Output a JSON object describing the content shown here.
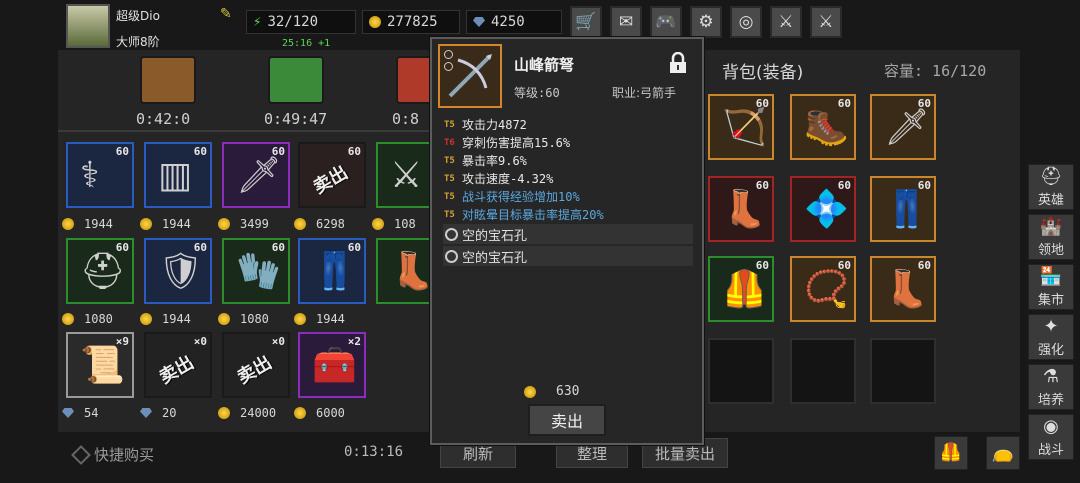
{
  "player": {
    "name": "超级Dio",
    "rank": "大师8阶"
  },
  "stats": {
    "energy": "32/120",
    "energy_timer": "25:16 +1",
    "gold": "277825",
    "gems": "4250"
  },
  "top_buttons": [
    {
      "name": "shop-cart",
      "icon": "🛒"
    },
    {
      "name": "mail",
      "icon": "✉"
    },
    {
      "name": "gamepad",
      "icon": "🎮"
    },
    {
      "name": "settings",
      "icon": "⚙"
    },
    {
      "name": "color-wheel",
      "icon": "◎"
    },
    {
      "name": "claws",
      "icon": "⚔"
    },
    {
      "name": "crossed-swords",
      "icon": "⚔"
    }
  ],
  "chests": [
    {
      "timer": "0:42:0",
      "color": "#8b5a2b"
    },
    {
      "timer": "0:49:47",
      "color": "#3a8a3a"
    },
    {
      "timer": "0:8",
      "color": "#b03a2a"
    }
  ],
  "shop": {
    "rows": [
      [
        {
          "level": "60",
          "price": "1944",
          "border": "#2a5bbf",
          "bg": "#1b2640",
          "art": "⚕"
        },
        {
          "level": "60",
          "price": "1944",
          "border": "#2a5bbf",
          "bg": "#1b2640",
          "art": "▥"
        },
        {
          "level": "60",
          "price": "3499",
          "border": "#8a2dbf",
          "bg": "#2a1b3a",
          "art": "🗡"
        },
        {
          "level": "60",
          "price": "6298",
          "border": "#1a1a1a",
          "bg": "#2a2020",
          "sold": "卖出",
          "art": ""
        },
        {
          "level": "",
          "price": "108",
          "border": "#2b8d2b",
          "bg": "#1a2a1a",
          "art": "⚔"
        }
      ],
      [
        {
          "level": "60",
          "price": "1080",
          "border": "#2b8d2b",
          "bg": "#1a2a1a",
          "art": "⛑"
        },
        {
          "level": "60",
          "price": "1944",
          "border": "#2a5bbf",
          "bg": "#1b2640",
          "art": "🛡"
        },
        {
          "level": "60",
          "price": "1080",
          "border": "#2b8d2b",
          "bg": "#1a2a1a",
          "art": "🧤"
        },
        {
          "level": "60",
          "price": "1944",
          "border": "#2a5bbf",
          "bg": "#1b2640",
          "art": "👖"
        },
        {
          "level": "",
          "price": "",
          "border": "#2b8d2b",
          "bg": "#1a2a1a",
          "art": "👢"
        }
      ],
      [
        {
          "level": "×9",
          "price": "54",
          "border": "#9a9a9a",
          "bg": "#2a2a2a",
          "art": "📜",
          "currency": "gem"
        },
        {
          "level": "×0",
          "price": "20",
          "border": "#1a1a1a",
          "bg": "#222",
          "sold": "卖出",
          "art": "",
          "currency": "gem"
        },
        {
          "level": "×0",
          "price": "24000",
          "border": "#1a1a1a",
          "bg": "#222",
          "sold": "卖出",
          "art": ""
        },
        {
          "level": "×2",
          "price": "6000",
          "border": "#8a2dbf",
          "bg": "#2a1b3a",
          "art": "🧰"
        }
      ]
    ],
    "quick_buy": "快捷购买",
    "refresh_timer": "0:13:16",
    "refresh_label": "刷新"
  },
  "tooltip": {
    "name": "山峰箭弩",
    "level": "等级:60",
    "job": "职业:弓箭手",
    "attributes": [
      {
        "tier": "T5",
        "tier_color": "#d4a030",
        "text": "攻击力4872",
        "color": "#e8e8e8"
      },
      {
        "tier": "T6",
        "tier_color": "#d43030",
        "text": "穿刺伤害提高15.6%",
        "color": "#e8e8e8"
      },
      {
        "tier": "T5",
        "tier_color": "#d4a030",
        "text": "暴击率9.6%",
        "color": "#e8e8e8"
      },
      {
        "tier": "T5",
        "tier_color": "#d4a030",
        "text": "攻击速度-4.32%",
        "color": "#e8e8e8"
      },
      {
        "tier": "T5",
        "tier_color": "#d4a030",
        "text": "战斗获得经验增加10%",
        "color": "#5aa8e0"
      },
      {
        "tier": "T5",
        "tier_color": "#d4a030",
        "text": "对眩晕目标暴击率提高20%",
        "color": "#5aa8e0"
      }
    ],
    "sockets": [
      "空的宝石孔",
      "空的宝石孔"
    ],
    "price": "630",
    "sell_label": "卖出"
  },
  "bag": {
    "title": "背包(装备)",
    "capacity": "容量: 16/120",
    "slots": [
      {
        "level": "60",
        "kind": "orange",
        "art": "🏹"
      },
      {
        "level": "60",
        "kind": "orange",
        "art": "🥾"
      },
      {
        "level": "60",
        "kind": "orange",
        "art": "🗡"
      },
      {
        "level": "60",
        "kind": "red",
        "art": "👢"
      },
      {
        "level": "60",
        "kind": "red",
        "art": "💠"
      },
      {
        "level": "60",
        "kind": "orange",
        "art": "👖"
      },
      {
        "level": "60",
        "kind": "green",
        "art": "🦺"
      },
      {
        "level": "60",
        "kind": "orange",
        "art": "📿"
      },
      {
        "level": "60",
        "kind": "orange",
        "art": "👢"
      },
      {
        "level": "",
        "kind": "empty",
        "art": ""
      },
      {
        "level": "",
        "kind": "empty",
        "art": ""
      },
      {
        "level": "",
        "kind": "empty",
        "art": ""
      }
    ],
    "sort_label": "整理",
    "bulk_sell_label": "批量卖出"
  },
  "side_menu": [
    {
      "label": "英雄",
      "icon": "⛑"
    },
    {
      "label": "领地",
      "icon": "🏰"
    },
    {
      "label": "集市",
      "icon": "🏪"
    },
    {
      "label": "强化",
      "icon": "✦"
    },
    {
      "label": "培养",
      "icon": "⚗"
    },
    {
      "label": "战斗",
      "icon": "◉"
    }
  ]
}
